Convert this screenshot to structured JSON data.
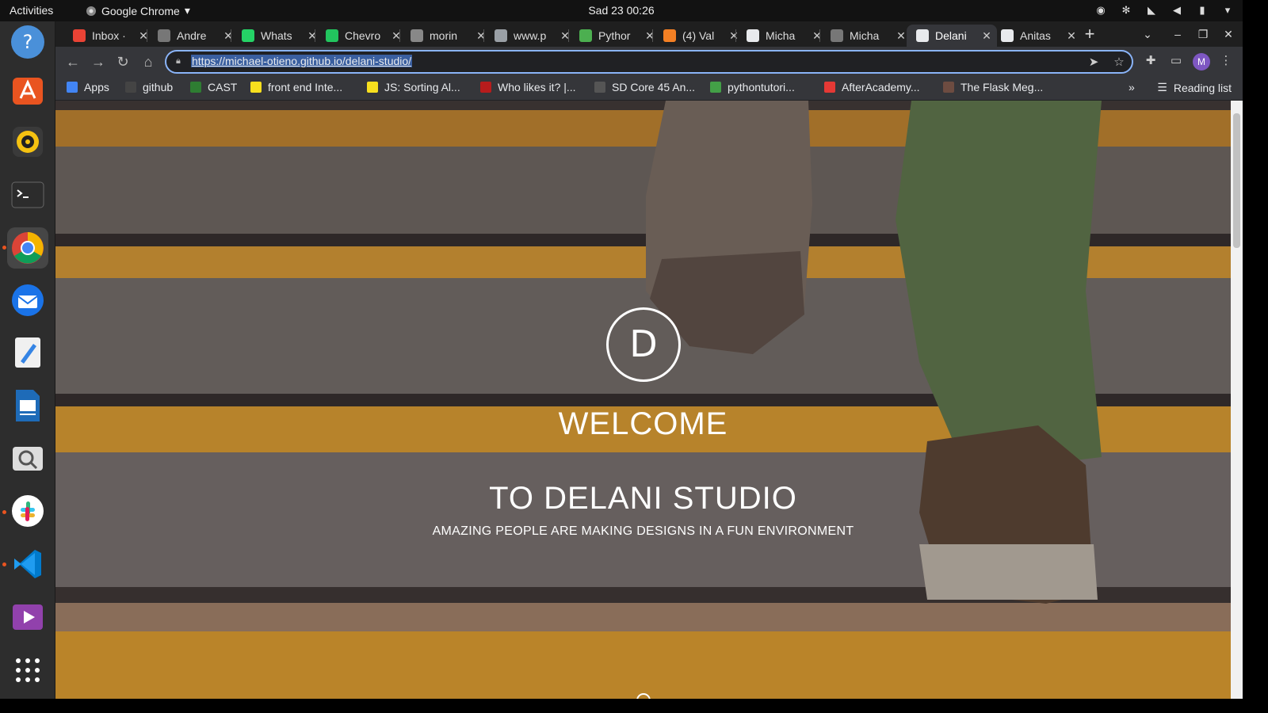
{
  "topbar": {
    "activities": "Activities",
    "app_name": "Google Chrome",
    "clock": "Sad 23  00:26"
  },
  "dock": {
    "items": [
      "help-icon",
      "ubuntu-software-icon",
      "rhythmbox-icon",
      "terminal-icon",
      "chrome-icon",
      "thunderbird-icon",
      "text-editor-icon",
      "libreoffice-writer-icon",
      "screenshot-icon",
      "slack-icon",
      "vscode-icon",
      "video-player-icon",
      "show-apps-icon"
    ]
  },
  "tabs": [
    {
      "label": "Inbox ·",
      "icon": "gmail-icon",
      "color": "#ea4335"
    },
    {
      "label": "Andre",
      "icon": "github-icon",
      "color": "#777777"
    },
    {
      "label": "Whats",
      "icon": "whatsapp-icon",
      "color": "#25d366"
    },
    {
      "label": "Chevro",
      "icon": "chevron-app-icon",
      "color": "#22c55e"
    },
    {
      "label": "morin",
      "icon": "moringa-icon",
      "color": "#888888"
    },
    {
      "label": "www.p",
      "icon": "globe-icon",
      "color": "#9aa0a6"
    },
    {
      "label": "Pythor",
      "icon": "pythontutor-icon",
      "color": "#4caf50"
    },
    {
      "label": "(4) Val",
      "icon": "stackoverflow-icon",
      "color": "#f48024"
    },
    {
      "label": "Micha",
      "icon": "globe-icon",
      "color": "#e8eaed"
    },
    {
      "label": "Micha",
      "icon": "github-icon",
      "color": "#777777"
    },
    {
      "label": "Delani",
      "icon": "globe-icon",
      "color": "#e8eaed",
      "active": true
    },
    {
      "label": "Anitas",
      "icon": "globe-icon",
      "color": "#e8eaed"
    }
  ],
  "toolbar": {
    "url": "https://michael-otieno.github.io/delani-studio/",
    "avatar_letter": "M"
  },
  "bookmarks": [
    {
      "label": "Apps",
      "color": "#4285f4"
    },
    {
      "label": "github",
      "color": "#444444"
    },
    {
      "label": "CAST",
      "color": "#2e7d32"
    },
    {
      "label": "front end Inte...",
      "color": "#f7df1e"
    },
    {
      "label": "JS: Sorting Al...",
      "color": "#f7df1e"
    },
    {
      "label": "Who likes it? |...",
      "color": "#b71c1c"
    },
    {
      "label": "SD Core 45 An...",
      "color": "#555555"
    },
    {
      "label": "pythontutori...",
      "color": "#43a047"
    },
    {
      "label": "AfterAcademy...",
      "color": "#e53935"
    },
    {
      "label": "The Flask Meg...",
      "color": "#6d4c41"
    }
  ],
  "reading_list": "Reading list",
  "hero": {
    "logo_letter": "D",
    "welcome": "WELCOME",
    "studio": "TO DELANI STUDIO",
    "tagline": "AMAZING PEOPLE ARE MAKING DESIGNS IN A FUN ENVIRONMENT"
  },
  "colors": {
    "stair_yellow": "#f2a51a",
    "stair_gray": "#6e6a62",
    "accent": "#8ab4f8"
  }
}
